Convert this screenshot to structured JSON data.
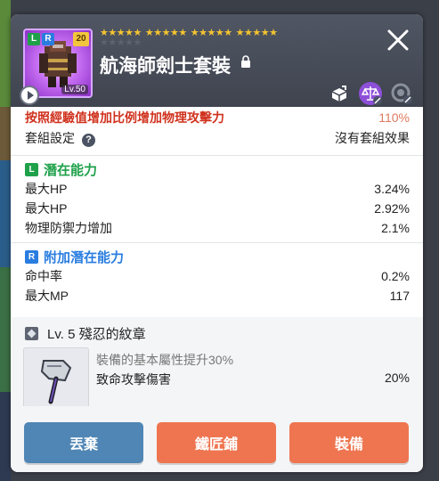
{
  "header": {
    "item_name": "航海師劍士套裝",
    "potential_badge": "L",
    "additional_badge": "R",
    "upgrade_level": "20",
    "required_level": "Lv.50",
    "stars_filled": 20,
    "stars_total": 25,
    "colors": {
      "star": "#f4c430",
      "star_empty": "#5e6370",
      "frame": "#d8a8ff"
    }
  },
  "stats": {
    "cut_row": {
      "label": "按照經驗值增加比例增加物理攻擊力",
      "value": "110%"
    },
    "set_row": {
      "label": "套組設定",
      "value": "沒有套組效果"
    }
  },
  "potential": {
    "icon": "L",
    "title": "潛在能力",
    "color": "#1fa14a",
    "items": [
      {
        "label": "最大HP",
        "value": "3.24%"
      },
      {
        "label": "最大HP",
        "value": "2.92%"
      },
      {
        "label": "物理防禦力增加",
        "value": "2.1%"
      }
    ]
  },
  "additional": {
    "icon": "R",
    "title": "附加潛在能力",
    "color": "#2a7de0",
    "items": [
      {
        "label": "命中率",
        "value": "0.2%"
      },
      {
        "label": "最大MP",
        "value": "117"
      }
    ]
  },
  "emblem": {
    "title": "Lv. 5 殘忍的紋章",
    "subtitle": "裝備的基本屬性提升30%",
    "stat_label": "致命攻擊傷害",
    "stat_value": "20%"
  },
  "buttons": {
    "discard": "丟棄",
    "blacksmith": "鐵匠鋪",
    "equip": "裝備",
    "colors": {
      "discard": "#4f86b5",
      "blacksmith": "#ee7550",
      "equip": "#ee7550"
    }
  },
  "icons": [
    "play-icon",
    "lock-icon",
    "close-icon",
    "share-icon",
    "scale-icon",
    "settings-icon",
    "help-icon"
  ]
}
